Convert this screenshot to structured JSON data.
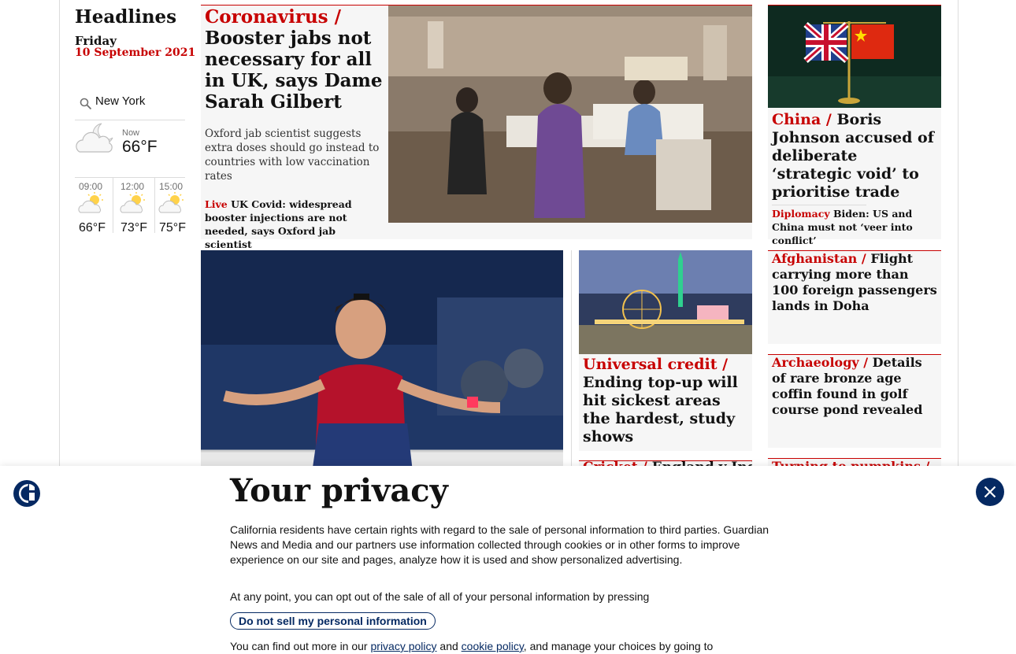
{
  "rail": {
    "title": "Headlines",
    "day": "Friday",
    "date": "10 September 2021",
    "location": "New York",
    "now_label": "Now",
    "now_temp": "66°F",
    "forecast": [
      {
        "time": "09:00",
        "temp": "66°F"
      },
      {
        "time": "12:00",
        "temp": "73°F"
      },
      {
        "time": "15:00",
        "temp": "75°F"
      }
    ]
  },
  "lead": {
    "kicker": "Coronavirus /",
    "headline": "Booster jabs not necessary for all in UK, says Dame Sarah Gilbert",
    "standfirst": "Oxford jab scientist suggests extra doses should go instead to countries with low vaccination rates",
    "sub_kicker": "Live",
    "sub_headline": "UK Covid: widespread booster injections are not needed, says Oxford jab scientist"
  },
  "china": {
    "kicker": "China /",
    "headline": "Boris Johnson accused of deliberate ‘strategic void’ to prioritise trade",
    "sub_kicker": "Diplomacy",
    "sub_headline": "Biden: US and China must not ‘veer into conflict’"
  },
  "credit": {
    "kicker": "Universal credit /",
    "headline": "Ending top-up will hit sickest areas the hardest, study shows"
  },
  "cricket": {
    "kicker": "Cricket /",
    "headline": "England v India"
  },
  "afghanistan": {
    "kicker": "Afghanistan /",
    "headline": "Flight carrying more than 100 foreign passengers lands in Doha"
  },
  "archaeology": {
    "kicker": "Archaeology /",
    "headline": "Details of rare bronze age coffin found in golf course pond revealed"
  },
  "pumpkins": {
    "kicker": "Turning to pumpkins /"
  },
  "privacy": {
    "title": "Your privacy",
    "body1": "California residents have certain rights with regard to the sale of personal information to third parties. Guardian News and Media and our partners use information collected through cookies or in other forms to improve experience on our site and pages, analyze how it is used and show personalized advertising.",
    "body2": "At any point, you can opt out of the sale of all of your personal information by pressing",
    "button": "Do not sell my personal information",
    "body3_start": "You can find out more in our",
    "link1": "privacy policy",
    "and": "and",
    "link2": "cookie policy",
    "body3_end": ", and manage your choices by going to"
  },
  "colors": {
    "news_red": "#c70000",
    "brand_blue": "#052962",
    "card_bg": "#f6f6f6"
  }
}
